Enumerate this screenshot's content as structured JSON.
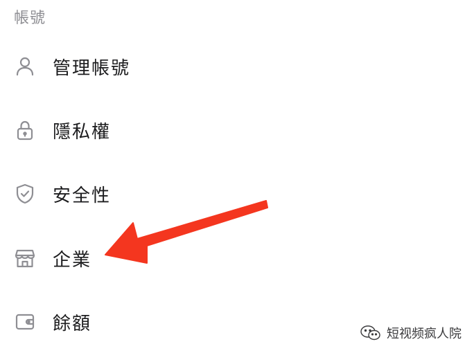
{
  "section": {
    "title": "帳號"
  },
  "menu": {
    "items": [
      {
        "label": "管理帳號",
        "icon": "person-icon"
      },
      {
        "label": "隱私權",
        "icon": "lock-icon"
      },
      {
        "label": "安全性",
        "icon": "shield-check-icon"
      },
      {
        "label": "企業",
        "icon": "storefront-icon"
      },
      {
        "label": "餘額",
        "icon": "wallet-icon"
      }
    ]
  },
  "annotation": {
    "arrow_color": "#f4361f"
  },
  "watermark": {
    "text": "短视频疯人院",
    "icon": "wechat-logo-icon"
  },
  "colors": {
    "icon": "#8e8e93",
    "label": "#1c1c1e",
    "section_title": "#8e8e93"
  }
}
